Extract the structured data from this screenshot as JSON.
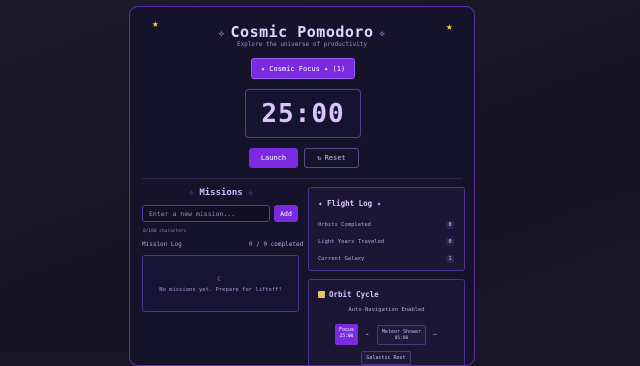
{
  "header": {
    "title": "Cosmic Pomodoro",
    "title_prefix": "✧",
    "title_suffix": "✧",
    "subtitle": "Explore the universe of productivity"
  },
  "mode_button": {
    "label": "✦ Cosmic Focus ✦ (1)"
  },
  "timer": {
    "display": "25:00"
  },
  "controls": {
    "launch_label": "Launch",
    "reset_label": "Reset",
    "reset_icon": "↻"
  },
  "missions": {
    "title": "Missions",
    "title_deco": "☆",
    "input_placeholder": "Enter a new mission...",
    "input_value": "",
    "add_label": "Add",
    "char_count": "0/100 characters",
    "log_label": "Mission Log",
    "log_count": "0 / 0 completed",
    "empty_icon": "☾",
    "empty_text": "No missions yet. Prepare for liftoff!"
  },
  "flight_log": {
    "title": "✦ Flight Log ✦",
    "rows": [
      {
        "label": "Orbits Completed",
        "value": "0"
      },
      {
        "label": "Light Years Traveled",
        "value": "0"
      },
      {
        "label": "Current Galaxy",
        "value": "1"
      }
    ]
  },
  "orbit_cycle": {
    "title": "Orbit Cycle",
    "auto_text": "Auto-Navigation Enabled",
    "steps": [
      {
        "name": "Focus",
        "time": "25:00"
      },
      {
        "name": "Meteor Shower",
        "time": "05:00"
      },
      {
        "name": "Galactic Rest",
        "time": ""
      }
    ],
    "arrow": "→"
  },
  "colors": {
    "accent": "#7a2be0",
    "background": "#181527",
    "star": "#f7d031"
  }
}
